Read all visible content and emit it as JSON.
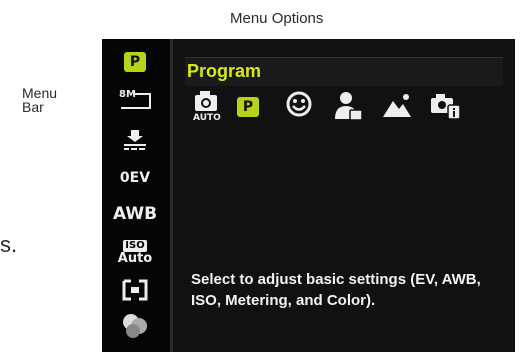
{
  "annotations": {
    "menu_options": "Menu Options",
    "menu_bar_line1": "Menu",
    "menu_bar_line2": "Bar",
    "fragment": "s."
  },
  "sidebar": {
    "items": [
      {
        "name": "program-mode-icon",
        "label": "P"
      },
      {
        "name": "image-size-icon",
        "label": "8M"
      },
      {
        "name": "quality-icon",
        "label": ""
      },
      {
        "name": "ev-icon",
        "label": "0EV"
      },
      {
        "name": "awb-icon",
        "label": "AWB"
      },
      {
        "name": "iso-auto-icon",
        "label_top": "ISO",
        "label_bottom": "Auto"
      },
      {
        "name": "metering-icon",
        "label": ""
      },
      {
        "name": "color-icon",
        "label": ""
      }
    ]
  },
  "panel": {
    "title": "Program",
    "title_color": "#d9e819",
    "accent_color": "#b8d21c",
    "modes": [
      {
        "name": "auto-mode-icon",
        "label": "AUTO"
      },
      {
        "name": "program-mode-icon",
        "label": "P"
      },
      {
        "name": "smile-mode-icon",
        "label": ""
      },
      {
        "name": "portrait-mode-icon",
        "label": ""
      },
      {
        "name": "landscape-mode-icon",
        "label": ""
      },
      {
        "name": "scene-info-mode-icon",
        "label": ""
      }
    ],
    "description": "Select to adjust basic settings (EV, AWB, ISO, Metering, and Color)."
  }
}
